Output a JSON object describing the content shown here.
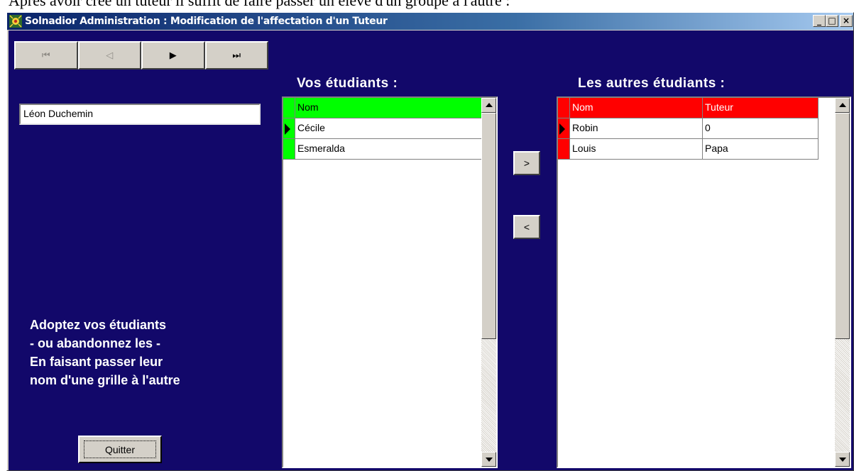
{
  "document": {
    "caption": "Après avoir créé un tuteur il suffit de faire passer un élève d'un groupe à l'autre :"
  },
  "window": {
    "title": "Solnadior  Administration : Modification de l'affectation d'un Tuteur",
    "controls": {
      "minimize": "_",
      "maximize": "□",
      "close": "×"
    }
  },
  "navigator": {
    "first": "⏮",
    "prev": "◁",
    "next": "▶",
    "last": "⏭"
  },
  "tutor_field": {
    "value": "Léon Duchemin"
  },
  "help": {
    "line1": "Adoptez vos étudiants",
    "line2": "- ou abandonnez les -",
    "line3": "En faisant passer leur",
    "line4": "nom d'une grille à l'autre"
  },
  "quit_button": {
    "label": "Quitter"
  },
  "my_students": {
    "title": "Vos étudiants :",
    "header_color": "#00ff00",
    "columns": [
      "Nom"
    ],
    "rows": [
      [
        "Cécile"
      ],
      [
        "Esmeralda"
      ]
    ],
    "current_row": 0
  },
  "other_students": {
    "title": "Les autres étudiants :",
    "header_color": "#ff0000",
    "columns": [
      "Nom",
      "Tuteur"
    ],
    "rows": [
      [
        "Robin",
        "0"
      ],
      [
        "Louis",
        "Papa"
      ]
    ],
    "current_row": 0
  },
  "move_buttons": {
    "adopt": ">",
    "abandon": "<"
  }
}
